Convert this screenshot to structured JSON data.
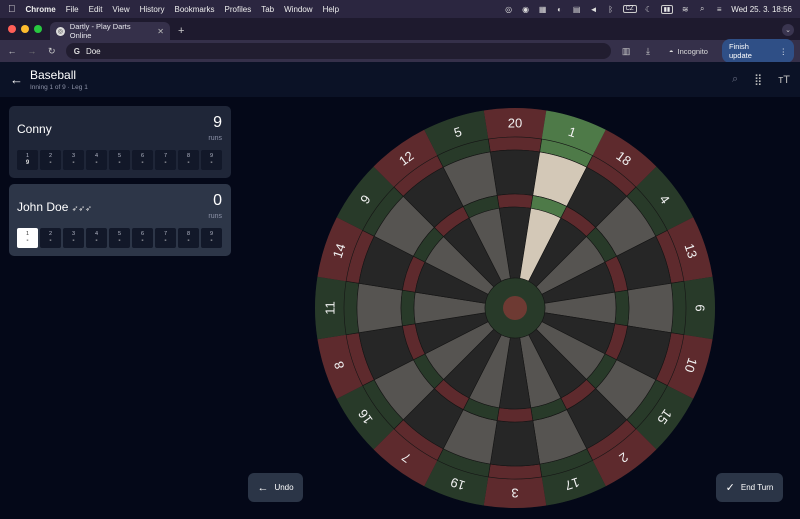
{
  "menubar": {
    "app": "Chrome",
    "items": [
      "File",
      "Edit",
      "View",
      "History",
      "Bookmarks",
      "Profiles",
      "Tab",
      "Window",
      "Help"
    ],
    "clock": "Wed 25. 3.  18:56"
  },
  "browser": {
    "tab_title": "Dartly - Play Darts Online",
    "address": "Doe",
    "incognito_label": "Incognito",
    "finish_update_label": "Finish update"
  },
  "app": {
    "title": "Baseball",
    "subtitle": "Inning 1 of 9 · Leg 1",
    "players": [
      {
        "name": "Conny",
        "score": "9",
        "unit": "runs",
        "innings": [
          {
            "n": "1",
            "v": "9"
          },
          {
            "n": "2",
            "v": "-"
          },
          {
            "n": "3",
            "v": "-"
          },
          {
            "n": "4",
            "v": "-"
          },
          {
            "n": "5",
            "v": "-"
          },
          {
            "n": "6",
            "v": "-"
          },
          {
            "n": "7",
            "v": "-"
          },
          {
            "n": "8",
            "v": "-"
          },
          {
            "n": "9",
            "v": "-"
          }
        ]
      },
      {
        "name": "John Doe",
        "darts_remaining": 3,
        "score": "0",
        "unit": "runs",
        "innings": [
          {
            "n": "1",
            "v": "-"
          },
          {
            "n": "2",
            "v": "-"
          },
          {
            "n": "3",
            "v": "-"
          },
          {
            "n": "4",
            "v": "-"
          },
          {
            "n": "5",
            "v": "-"
          },
          {
            "n": "6",
            "v": "-"
          },
          {
            "n": "7",
            "v": "-"
          },
          {
            "n": "8",
            "v": "-"
          },
          {
            "n": "9",
            "v": "-"
          }
        ]
      }
    ],
    "undo_label": "Undo",
    "end_turn_label": "End Turn"
  },
  "dartboard": {
    "numbers": [
      20,
      1,
      18,
      4,
      13,
      6,
      10,
      15,
      2,
      17,
      3,
      19,
      7,
      16,
      8,
      11,
      14,
      9,
      12,
      5
    ],
    "highlighted_segment": 1,
    "colors": {
      "dark": "#262626",
      "light": "#565451",
      "red": "#5e2a2d",
      "green": "#283a29",
      "hl_light": "#d3c8b7",
      "hl_green": "#4e7a48",
      "number_ring": "#161a22",
      "bull_red": "#6e3a33"
    }
  }
}
